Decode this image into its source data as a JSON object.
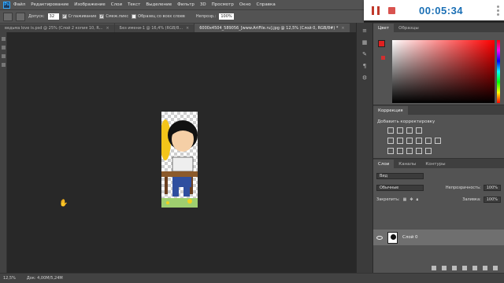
{
  "menubar": {
    "logo": "Ps",
    "items": [
      "Файл",
      "Редактирование",
      "Изображение",
      "Слои",
      "Текст",
      "Выделение",
      "Фильтр",
      "3D",
      "Просмотр",
      "Окно",
      "Справка"
    ]
  },
  "recorder": {
    "time": "00:05:34"
  },
  "options": {
    "tolerance_label": "Допуск:",
    "tolerance_value": "32",
    "antialias_label": "Сглаживание",
    "antialias_checked": true,
    "contiguous_label": "Смеж.пикс",
    "contiguous_checked": true,
    "sample_all_label": "Образец со всех слоев",
    "sample_all_checked": false,
    "opacity_label": "Непрозр.:",
    "opacity_value": "100%"
  },
  "tabs": [
    {
      "label": "ведьма love is.psd @ 25% (Слой 2 копия 10, R...",
      "active": false
    },
    {
      "label": "Без имени-1 @ 16,4% (RGB/8...",
      "active": false
    },
    {
      "label": "6000x4504_589056_[www.ArtFile.ru].jpg @ 12,5% (Слой 0, RGB/8#) *",
      "active": true
    }
  ],
  "statusbar": {
    "zoom": "12,5%",
    "doc_size": "Док: 4,00M/5,24M"
  },
  "panels": {
    "color_tabs": [
      "Цвет",
      "Образцы"
    ],
    "fg_color": "#e02020",
    "bg_color": "#ffffff",
    "adjust_tabs": [
      "Коррекция"
    ],
    "adjust_title": "Добавить корректировку",
    "layers_tabs": [
      "Слои",
      "Каналы",
      "Контуры"
    ],
    "kind_label": "Вид",
    "blend_mode": "Обычные",
    "opacity_label": "Непрозрачность:",
    "opacity_value": "100%",
    "lock_label": "Закрепить:",
    "fill_label": "Заливка:",
    "fill_value": "100%",
    "layer_name": "Слой 0"
  }
}
